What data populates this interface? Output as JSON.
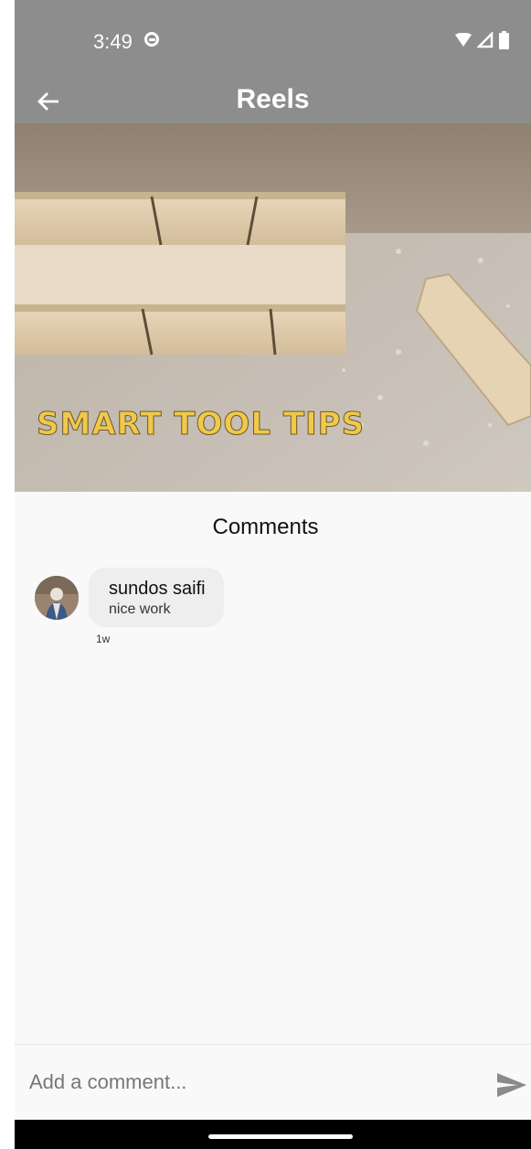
{
  "status_bar": {
    "time": "3:49"
  },
  "app_bar": {
    "title": "Reels"
  },
  "video": {
    "overlay_text": "SMART TOOL TIPS"
  },
  "comments": {
    "heading": "Comments",
    "items": [
      {
        "author": "sundos saifi",
        "text": "nice work",
        "age": "1w"
      }
    ]
  },
  "composer": {
    "placeholder": "Add a comment..."
  },
  "colors": {
    "app_bar": "#8d8d8d",
    "page_background": "#f9f9f9",
    "comment_bubble": "#eeeeee",
    "overlay_text": "#f0c94a"
  }
}
